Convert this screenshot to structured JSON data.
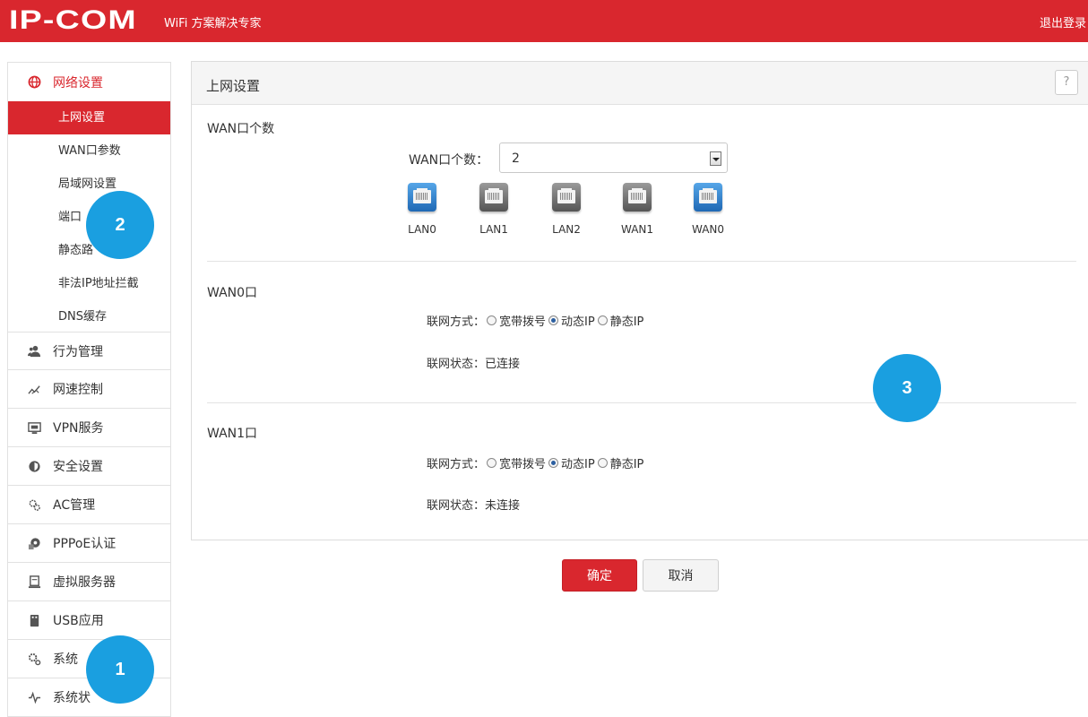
{
  "header": {
    "logo": "IP-COM",
    "tagline": "WiFi 方案解决专家",
    "logout": "退出登录"
  },
  "sidebar": {
    "groups": [
      {
        "label": "网络设置",
        "icon": "globe-icon",
        "active": true
      },
      {
        "label": "行为管理",
        "icon": "users-icon"
      },
      {
        "label": "网速控制",
        "icon": "speed-icon"
      },
      {
        "label": "VPN服务",
        "icon": "monitor-icon"
      },
      {
        "label": "安全设置",
        "icon": "shield-icon"
      },
      {
        "label": "AC管理",
        "icon": "gear-cluster-icon"
      },
      {
        "label": "PPPoE认证",
        "icon": "pppoe-icon"
      },
      {
        "label": "虚拟服务器",
        "icon": "server-icon"
      },
      {
        "label": "USB应用",
        "icon": "usb-icon"
      },
      {
        "label": "系统",
        "icon": "settings-icon"
      },
      {
        "label": "系统状",
        "icon": "pulse-icon"
      }
    ],
    "subitems": [
      {
        "label": "上网设置",
        "active": true
      },
      {
        "label": "WAN口参数"
      },
      {
        "label": "局域网设置"
      },
      {
        "label": "端口"
      },
      {
        "label": "静态路"
      },
      {
        "label": "非法IP地址拦截"
      },
      {
        "label": "DNS缓存"
      }
    ]
  },
  "panel": {
    "title": "上网设置",
    "help": "?",
    "wan_count_section": {
      "title": "WAN口个数",
      "label": "WAN口个数：",
      "value": "2"
    },
    "ports": [
      {
        "label": "LAN0",
        "color": "blue"
      },
      {
        "label": "LAN1",
        "color": "gray"
      },
      {
        "label": "LAN2",
        "color": "gray"
      },
      {
        "label": "WAN1",
        "color": "gray"
      },
      {
        "label": "WAN0",
        "color": "blue"
      }
    ],
    "wan0": {
      "title": "WAN0口",
      "mode_label": "联网方式：",
      "options": [
        "宽带拨号",
        "动态IP",
        "静态IP"
      ],
      "selected": "动态IP",
      "status_label": "联网状态：",
      "status_value": "已连接"
    },
    "wan1": {
      "title": "WAN1口",
      "mode_label": "联网方式：",
      "options": [
        "宽带拨号",
        "动态IP",
        "静态IP"
      ],
      "selected": "动态IP",
      "status_label": "联网状态：",
      "status_value": "未连接"
    }
  },
  "buttons": {
    "ok": "确定",
    "cancel": "取消"
  },
  "callouts": [
    "1",
    "2",
    "3"
  ],
  "colors": {
    "brand_red": "#d9272e",
    "callout_blue": "#1a9fe0",
    "port_blue": "#1f68b4"
  }
}
